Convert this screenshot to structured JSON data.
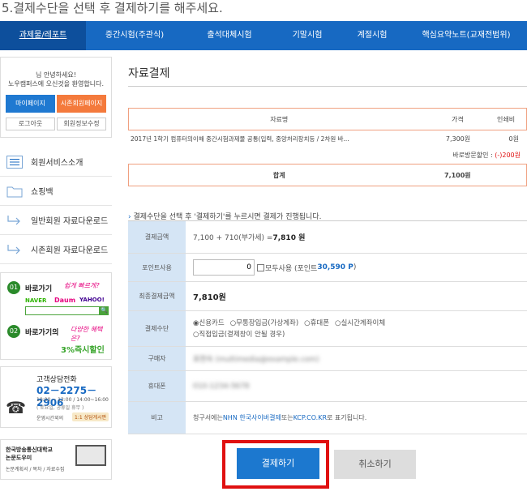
{
  "heading": "5.결제수단을 선택 후 결제하기를 해주세요.",
  "nav": {
    "items": [
      "과제물/레포트",
      "중간시험(주관식)",
      "출석대체시험",
      "기말시험",
      "계절시험",
      "핵심요약노트(교재전범위)"
    ]
  },
  "sidebar": {
    "greeting_line1": "님 안녕하세요!",
    "greeting_line2": "노우캠퍼스에 오신것을 환영합니다.",
    "mypage": "마이페이지",
    "external": "시존회원페이지",
    "logout": "로그아웃",
    "member_edit": "회원정보수정",
    "menu": [
      {
        "label": "회원서비스소개",
        "icon": "list-icon"
      },
      {
        "label": "쇼핑백",
        "icon": "folder-icon"
      },
      {
        "label": "일반회원 자료다운로드",
        "icon": "arrow-right-icon"
      },
      {
        "label": "시존회원 자료다운로드",
        "icon": "arrow-right-icon"
      }
    ],
    "promo1": {
      "num1": "01",
      "text1": "바로가기",
      "slogan1": "쉽게 빠르게?",
      "logos": [
        "NAVER",
        "Daum",
        "YAHOO!"
      ],
      "num2": "02",
      "text2": "바로가기의",
      "slogan2": "다양한 혜택은?",
      "discount": "3%즉시할인"
    },
    "contact": {
      "title": "고객상담전화",
      "phone": "02－2275－2906",
      "hours1": "10:00 ~ 12:00 / 14:00~16:00",
      "hours2": "( 토요일, 공휴일 휴무 )",
      "op_label": "운영시간외의",
      "online": "1:1 상담게시판"
    },
    "promo2": {
      "line1": "한국방송통신대학교",
      "line2": "논문도우미",
      "line3": "논문계획서 / 목차 / 자료수집"
    }
  },
  "main": {
    "title": "자료결제",
    "table": {
      "headers": [
        "자료명",
        "가격",
        "인쇄비"
      ],
      "row": {
        "name": "2017년 1학기 컴퓨터의이해 중간시험과제물 공통(입력, 중앙처리장치등 / 2차원 바...",
        "price": "7,300원",
        "print": "0원"
      },
      "discount_label": "바로방문할인 :",
      "discount_value": "(-)200원",
      "total_label": "합계",
      "total_value": "7,100원"
    },
    "notice": "결제수단을 선택 후 '결제하기'를 누르시면 결제가 진행됩니다.",
    "pay": {
      "amount_label": "결제금액",
      "amount_calc": "7,100 + 710(부가세) = ",
      "amount_total": "7,810 원",
      "point_label": "포인트사용",
      "point_value": "0",
      "point_all": "모두사용 (포인트 ",
      "point_balance": "30,590 P",
      "point_close": ")",
      "final_label": "최종결제금액",
      "final_value": "7,810원",
      "method_label": "결제수단",
      "methods": [
        "신용카드",
        "무통장입금(가상계좌)",
        "휴대폰",
        "실시간계좌이체",
        "직접입금(결제창이 안될 경우)"
      ],
      "buyer_label": "구매자",
      "buyer_value": "표현숙 (multimedia@example.com)",
      "phone_label": "휴대폰",
      "phone_value": "010-1234-5678",
      "note_label": "비고",
      "note_prefix": "청구서에는 ",
      "note_company": "NHN 한국사이버결제",
      "note_mid": " 또는 ",
      "note_domain": "KCP.CO.KR",
      "note_suffix": "로 표기됩니다."
    },
    "submit": "결제하기",
    "cancel": "취소하기"
  },
  "colors": {
    "nav": "#1769c2",
    "label_bg": "#d5e5f5",
    "orange": "#f47a3c",
    "highlight": "#e01010"
  }
}
